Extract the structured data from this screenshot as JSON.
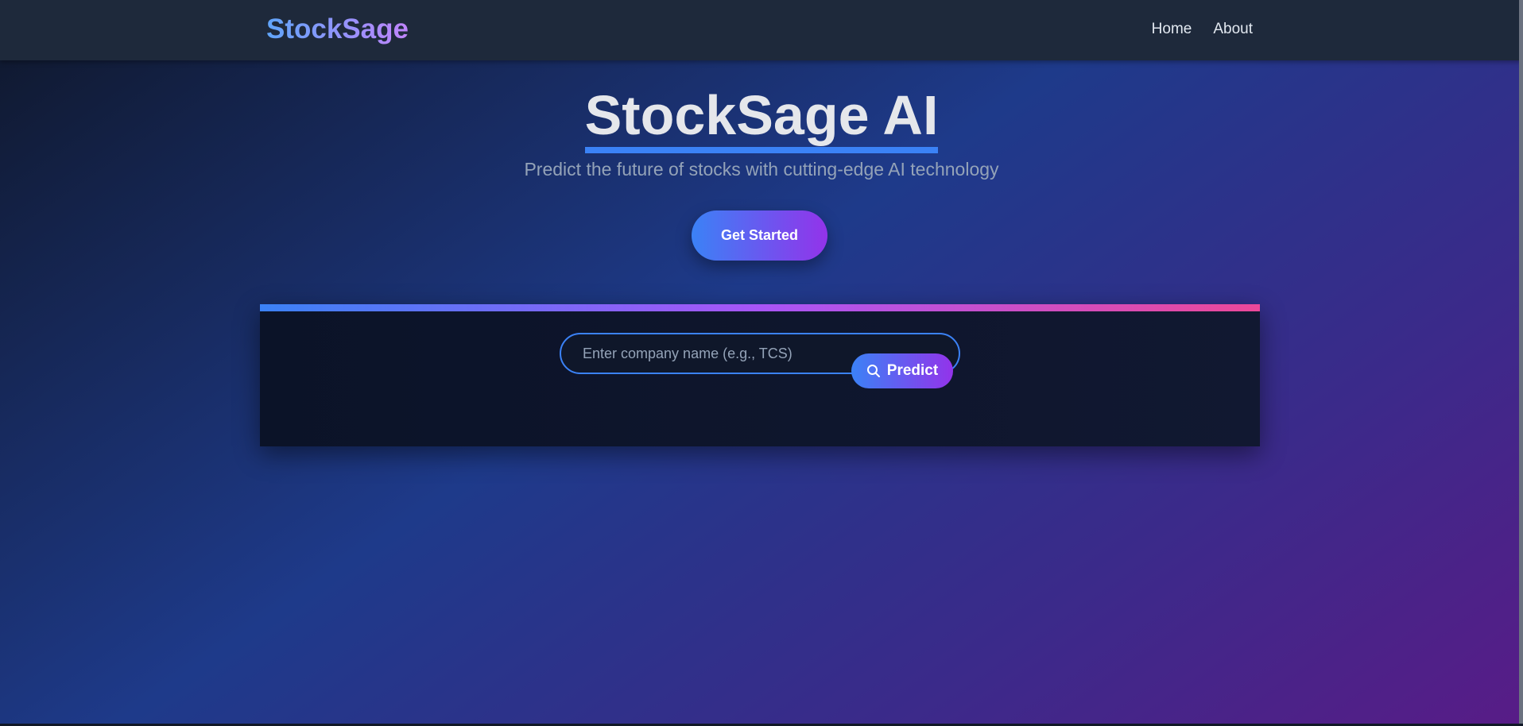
{
  "navbar": {
    "brand": "StockSage",
    "links": [
      {
        "label": "Home"
      },
      {
        "label": "About"
      }
    ]
  },
  "hero": {
    "title": "StockSage AI",
    "subtitle": "Predict the future of stocks with cutting-edge AI technology",
    "cta_label": "Get Started"
  },
  "search": {
    "placeholder": "Enter company name (e.g., TCS)",
    "value": "",
    "button_label": "Predict",
    "button_icon": "search-icon"
  },
  "colors": {
    "accent_blue": "#3b82f6",
    "accent_purple": "#9333ea",
    "accent_pink": "#ec4899",
    "navbar_bg": "#1e293b"
  }
}
